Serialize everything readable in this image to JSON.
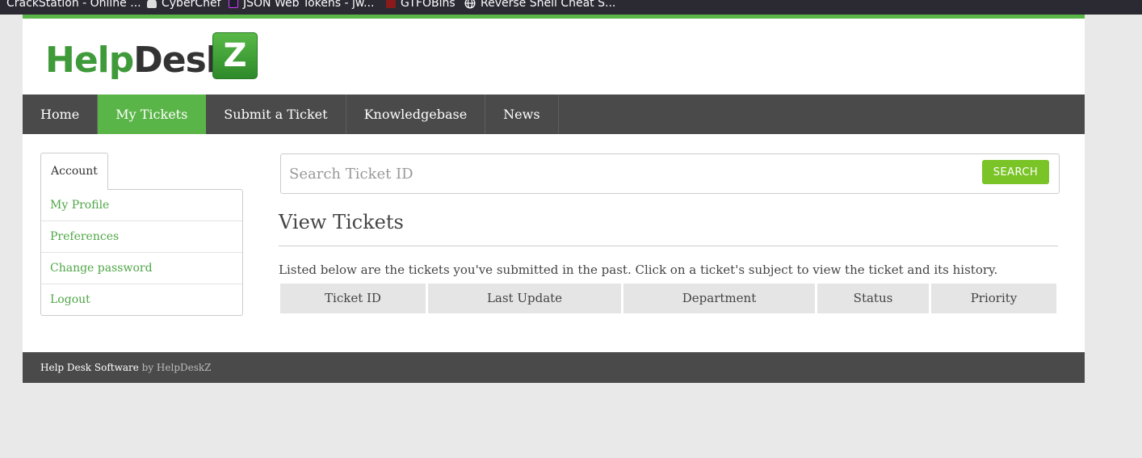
{
  "bookmarks": [
    {
      "label": "CrackStation - Online ...",
      "icon": "crackstation-icon"
    },
    {
      "label": "CyberChef",
      "icon": "chef-hat-icon"
    },
    {
      "label": "JSON Web Tokens - jw...",
      "icon": "jwt-icon"
    },
    {
      "label": "GTFOBins",
      "icon": "gtfobins-icon"
    },
    {
      "label": "Reverse Shell Cheat S...",
      "icon": "globe-icon"
    }
  ],
  "logo": {
    "part1": "Help",
    "part2": "Desk",
    "badge": "Z"
  },
  "nav": {
    "items": [
      {
        "label": "Home"
      },
      {
        "label": "My Tickets",
        "active": true
      },
      {
        "label": "Submit a Ticket"
      },
      {
        "label": "Knowledgebase"
      },
      {
        "label": "News"
      }
    ]
  },
  "sidebar": {
    "tab_label": "Account",
    "items": [
      {
        "label": "My Profile"
      },
      {
        "label": "Preferences"
      },
      {
        "label": "Change password"
      },
      {
        "label": "Logout"
      }
    ]
  },
  "search": {
    "placeholder": "Search Ticket ID",
    "value": "",
    "button_label": "SEARCH"
  },
  "main": {
    "title": "View Tickets",
    "description": "Listed below are the tickets you've submitted in the past. Click on a ticket's subject to view the ticket and its history.",
    "columns": [
      "Ticket ID",
      "Last Update",
      "Department",
      "Status",
      "Priority"
    ]
  },
  "footer": {
    "text1": "Help Desk Software",
    "text2": " by HelpDeskZ"
  },
  "colors": {
    "accent": "#5ab548",
    "nav_bg": "#4a4a4a",
    "search_button": "#7bc428"
  }
}
